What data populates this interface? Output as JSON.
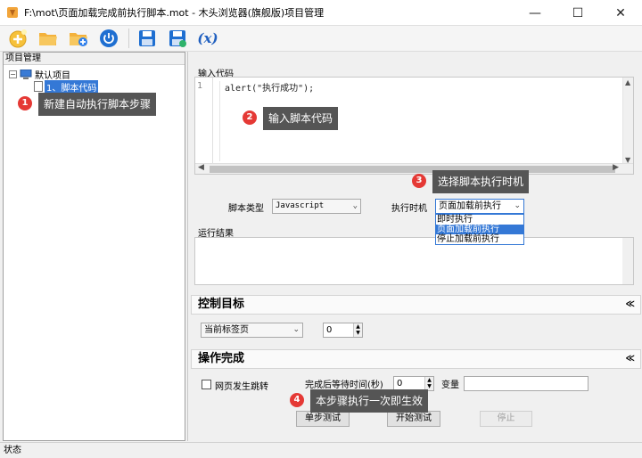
{
  "window": {
    "title": "F:\\mot\\页面加载完成前执行脚本.mot  - 木头浏览器(旗舰版)项目管理",
    "minimize": "—",
    "maximize": "☐",
    "close": "✕"
  },
  "toolbar": {
    "items": [
      "new-project",
      "open-folder",
      "add-folder",
      "power",
      "save",
      "save-as",
      "variable"
    ],
    "variable_label": "(x)"
  },
  "left_panel": {
    "title": "项目管理",
    "tree": {
      "root_label": "默认项目",
      "root_expander": "−",
      "child_label": "1、脚本代码"
    }
  },
  "code_section": {
    "title": "输入代码",
    "line_number": "1",
    "code": "alert(\"执行成功\");"
  },
  "script_settings": {
    "type_label": "脚本类型",
    "type_value": "Javascript",
    "timing_label": "执行时机",
    "timing_value": "页面加载前执行",
    "timing_options": [
      "即时执行",
      "页面加载前执行",
      "停止加载前执行"
    ],
    "timing_selected_index": 1
  },
  "result_section": {
    "title": "运行结果"
  },
  "control_section": {
    "title": "控制目标",
    "chevron": "≪",
    "target_value": "当前标签页",
    "index_value": "0"
  },
  "complete_section": {
    "title": "操作完成",
    "chevron": "≪",
    "jump_label": "网页发生跳转",
    "jump_checked": false,
    "wait_label": "完成后等待时间(秒)",
    "wait_value": "0",
    "var_label": "变量",
    "var_value": ""
  },
  "buttons": {
    "step_test": "单步测试",
    "start_test": "开始测试",
    "stop": "停止"
  },
  "callouts": [
    {
      "number": "1",
      "text": "新建自动执行脚本步骤"
    },
    {
      "number": "2",
      "text": "输入脚本代码"
    },
    {
      "number": "3",
      "text": "选择脚本执行时机"
    },
    {
      "number": "4",
      "text": "本步骤执行一次即生效"
    }
  ],
  "status": {
    "text": "状态"
  },
  "colors": {
    "accent": "#3478d6",
    "callout_bg": "#555555",
    "badge": "#e53935"
  }
}
